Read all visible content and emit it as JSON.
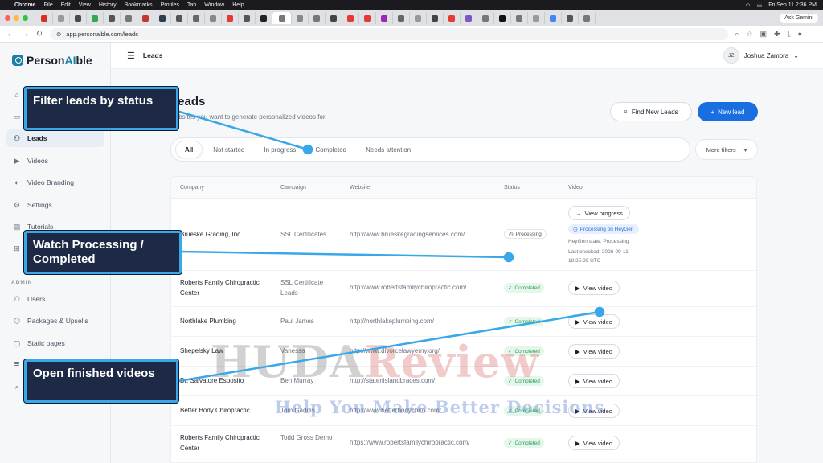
{
  "os_menu": {
    "apple": "",
    "items": [
      "Chrome",
      "File",
      "Edit",
      "View",
      "History",
      "Bookmarks",
      "Profiles",
      "Tab",
      "Window",
      "Help"
    ],
    "clock": "Fri Sep 11  2:36 PM"
  },
  "browser": {
    "url": "app.personaible.com/leads",
    "ask_label": "Ask Gemini"
  },
  "brand": {
    "name_part1": "Person",
    "name_ai": "AI",
    "name_part2": "ble",
    "accent": "#1b7fa6"
  },
  "sidebar": {
    "items": [
      {
        "label": "Dashboard",
        "icon": "home-icon"
      },
      {
        "label": "Campaigns",
        "icon": "briefcase-icon"
      },
      {
        "label": "Leads",
        "icon": "users-icon"
      },
      {
        "label": "Videos",
        "icon": "video-icon"
      },
      {
        "label": "Video Branding",
        "icon": "palette-icon"
      },
      {
        "label": "Settings",
        "icon": "gear-icon"
      },
      {
        "label": "Tutorials",
        "icon": "book-icon"
      },
      {
        "label": "Gifts",
        "icon": "gift-icon"
      }
    ],
    "admin_label": "ADMIN",
    "admin_items": [
      {
        "label": "Users",
        "icon": "users-icon"
      },
      {
        "label": "Packages & Upsells",
        "icon": "package-icon"
      },
      {
        "label": "Static pages",
        "icon": "pages-icon"
      },
      {
        "label": "Logs",
        "icon": "list-icon"
      },
      {
        "label": "Search",
        "icon": "search-icon"
      }
    ]
  },
  "topbar": {
    "title": "Leads",
    "user_initials": "JZ",
    "user_name": "Joshua Zamora"
  },
  "page": {
    "title": "Leads",
    "subtitle": "websites you want to generate personalized videos for.",
    "find_button": "Find New Leads",
    "new_button": "New lead",
    "primary_color": "#1a6fe0"
  },
  "filters": {
    "tabs": [
      "All",
      "Not started",
      "In progress",
      "Completed",
      "Needs attention"
    ],
    "active": "All",
    "more": "More filters"
  },
  "table": {
    "headers": [
      "Company",
      "Campaign",
      "Website",
      "Status",
      "Video"
    ],
    "rows": [
      {
        "company": "Brueske Grading, Inc.",
        "campaign": "SSL Certificates",
        "website": "http://www.brueskegradingservices.com/",
        "status": "Processing",
        "video_action": "View progress",
        "heygen": "Processing on HeyGen",
        "meta1": "HeyGen state: Processing",
        "meta2": "Last checked: 2026-09-11",
        "meta3": "18:35:39 UTC"
      },
      {
        "company": "Roberts Family Chiropractic Center",
        "campaign": "SSL Certificate Leads",
        "website": "http://www.robertsfamilychiropractic.com/",
        "status": "Completed",
        "video_action": "View video"
      },
      {
        "company": "Northlake Plumbing",
        "campaign": "Paul James",
        "website": "http://northlakeplumbing.com/",
        "status": "Completed",
        "video_action": "View video"
      },
      {
        "company": "Shepelsky Law",
        "campaign": "Vanessa",
        "website": "http://www.divorcelawyerny.org/",
        "status": "Completed",
        "video_action": "View video"
      },
      {
        "company": "Dr. Salvatore Esposito",
        "campaign": "Ben Murray",
        "website": "http://statenislandbraces.com/",
        "status": "Completed",
        "video_action": "View video"
      },
      {
        "company": "Better Body Chiropractic",
        "campaign": "Tom Gaddis",
        "website": "http://www.betterbodychiro.com/",
        "status": "Completed",
        "video_action": "View video"
      },
      {
        "company": "Roberts Family Chiropractic Center",
        "campaign": "Todd Gross Demo",
        "website": "https://www.robertsfamilychiropractic.com/",
        "status": "Completed",
        "video_action": "View video"
      }
    ]
  },
  "callouts": {
    "filter": "Filter leads by status",
    "processing": "Watch Processing / Completed",
    "open": "Open finished videos",
    "border_color": "#38a8e8"
  },
  "watermark": {
    "line1a": "HUDA",
    "line1b": "Review",
    "line2": "Help You Make Better Decisions"
  }
}
